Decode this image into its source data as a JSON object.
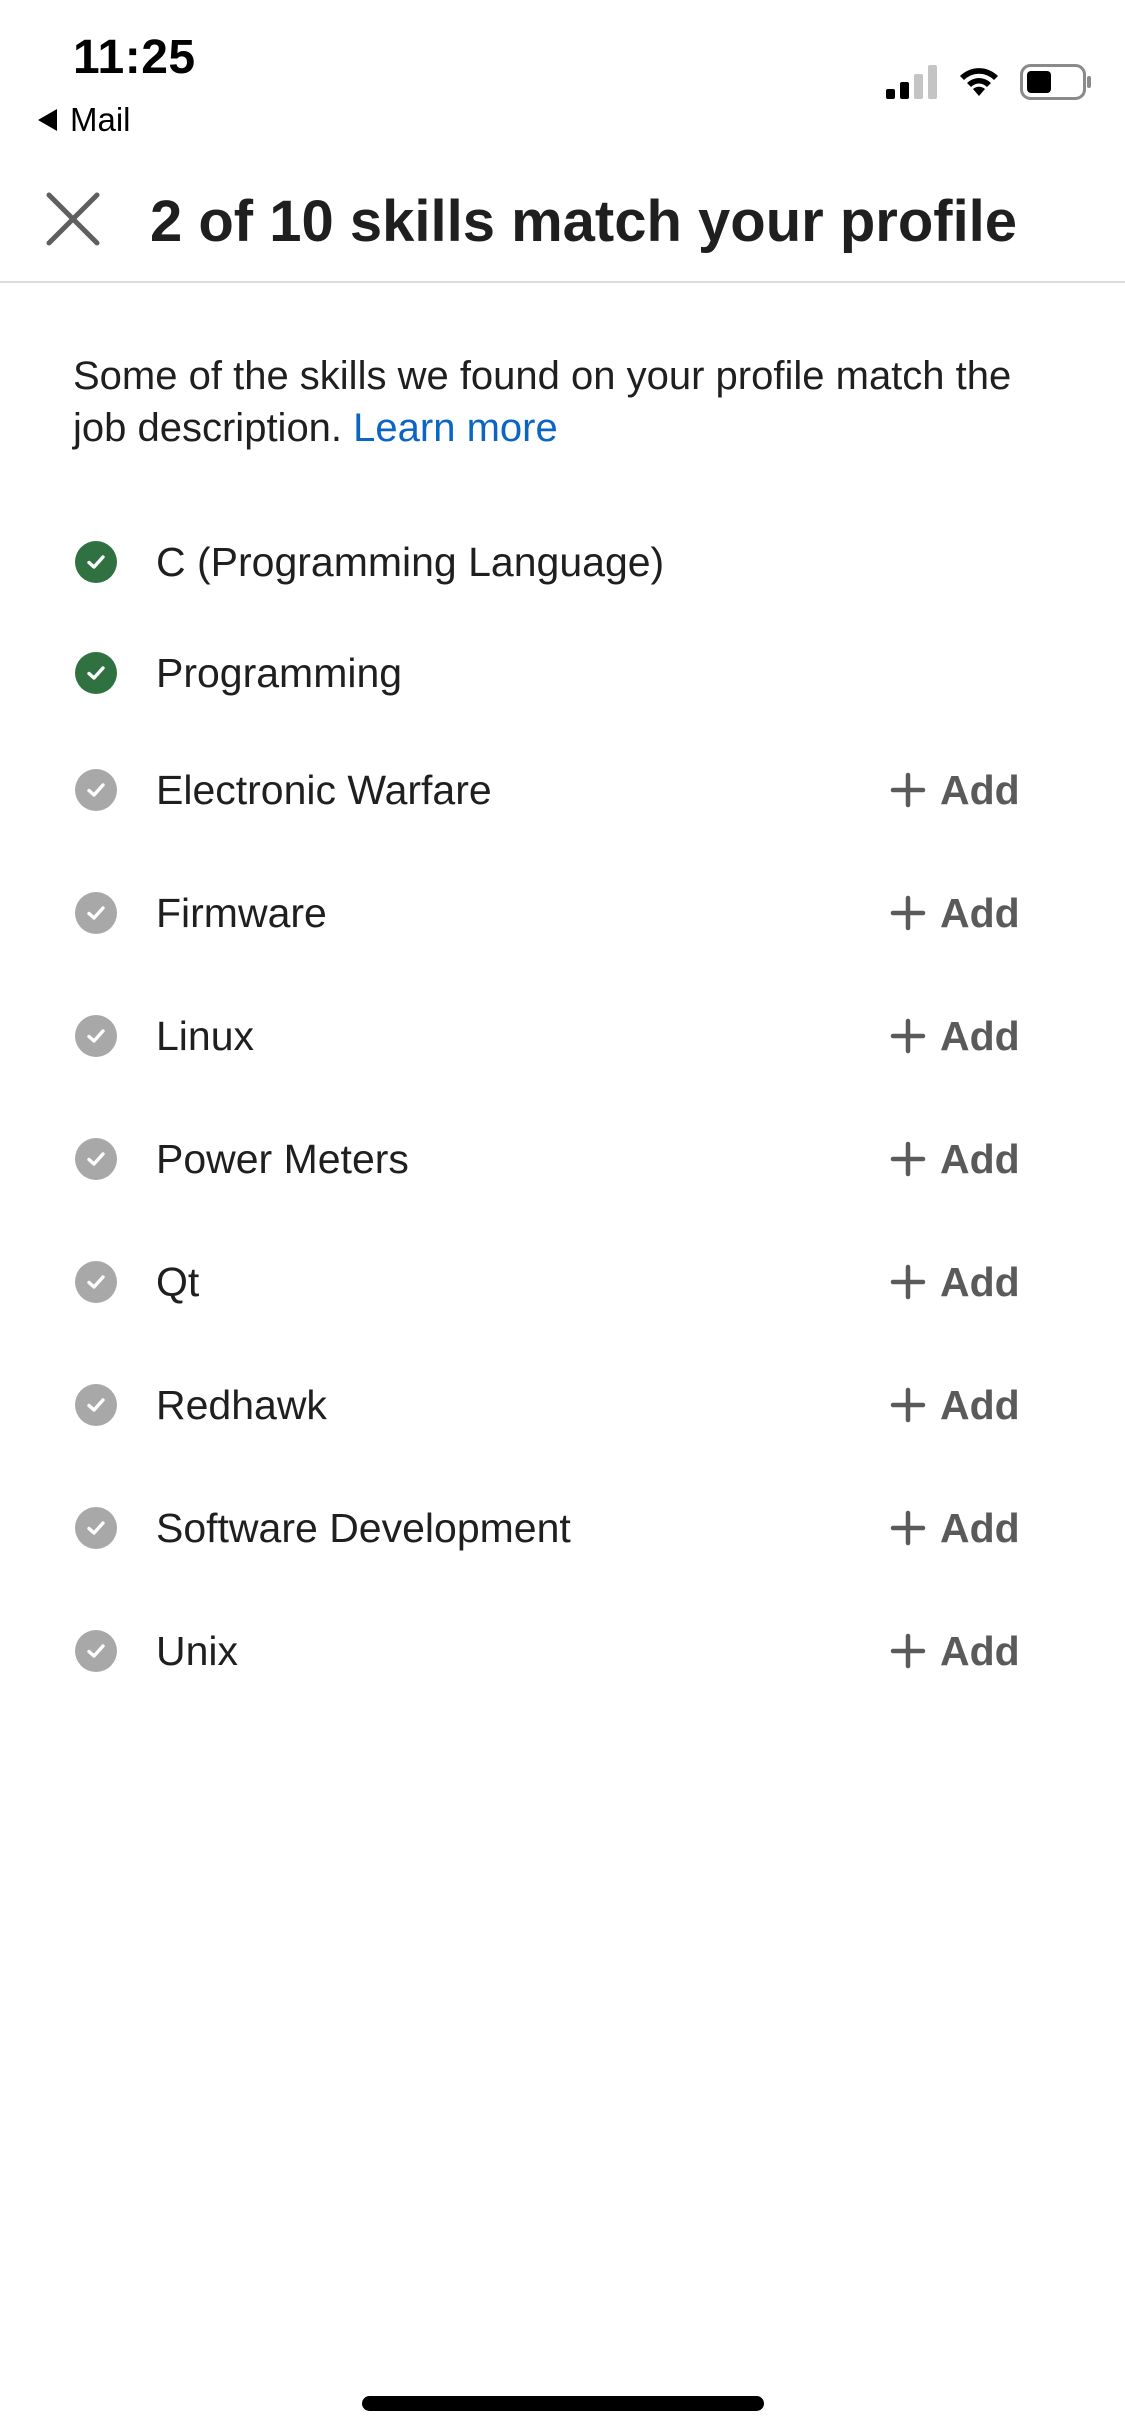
{
  "status_bar": {
    "time": "11:25",
    "back_app": "Mail",
    "icons": [
      "cellular-signal-icon",
      "wifi-icon",
      "battery-icon"
    ]
  },
  "header": {
    "close_icon": "close-icon",
    "title": "2 of 10 skills match your profile"
  },
  "intro": {
    "text": "Some of the skills we found on your profile match the job description. ",
    "link": "Learn more"
  },
  "colors": {
    "matched": "#2f7140",
    "unmatched": "#a8a8a8",
    "link": "#0a66c2"
  },
  "skills": [
    {
      "name": "C (Programming Language)",
      "matched": true
    },
    {
      "name": "Programming",
      "matched": true
    },
    {
      "name": "Electronic Warfare",
      "matched": false,
      "action": "Add"
    },
    {
      "name": "Firmware",
      "matched": false,
      "action": "Add"
    },
    {
      "name": "Linux",
      "matched": false,
      "action": "Add"
    },
    {
      "name": "Power Meters",
      "matched": false,
      "action": "Add"
    },
    {
      "name": "Qt",
      "matched": false,
      "action": "Add"
    },
    {
      "name": "Redhawk",
      "matched": false,
      "action": "Add"
    },
    {
      "name": "Software Development",
      "matched": false,
      "action": "Add"
    },
    {
      "name": "Unix",
      "matched": false,
      "action": "Add"
    }
  ]
}
